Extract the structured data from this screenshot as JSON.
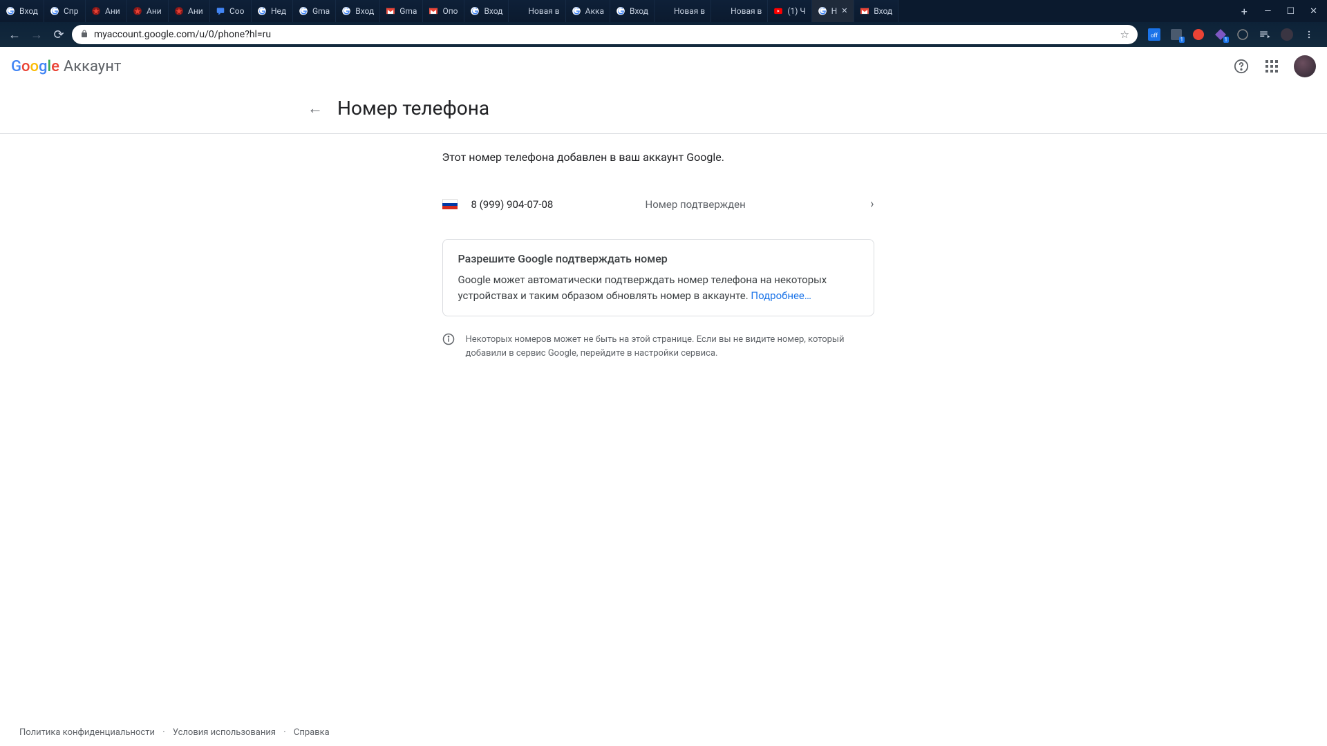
{
  "browser": {
    "tabs": [
      {
        "label": "Вход",
        "icon": "google"
      },
      {
        "label": "Спр",
        "icon": "google"
      },
      {
        "label": "Ани",
        "icon": "red"
      },
      {
        "label": "Ани",
        "icon": "red"
      },
      {
        "label": "Ани",
        "icon": "red"
      },
      {
        "label": "Соо",
        "icon": "chat"
      },
      {
        "label": "Нед",
        "icon": "google"
      },
      {
        "label": "Gma",
        "icon": "google"
      },
      {
        "label": "Вход",
        "icon": "google"
      },
      {
        "label": "Gma",
        "icon": "gmail"
      },
      {
        "label": "Опо",
        "icon": "gmail"
      },
      {
        "label": "Вход",
        "icon": "google"
      },
      {
        "label": "Новая в",
        "icon": "none"
      },
      {
        "label": "Акка",
        "icon": "google"
      },
      {
        "label": "Вход",
        "icon": "google"
      },
      {
        "label": "Новая в",
        "icon": "none"
      },
      {
        "label": "Новая в",
        "icon": "none"
      },
      {
        "label": "(1) Ч",
        "icon": "youtube"
      },
      {
        "label": "Н",
        "icon": "google",
        "active": true,
        "close": true
      },
      {
        "label": "Вход",
        "icon": "gmail"
      }
    ],
    "url": "myaccount.google.com/u/0/phone?hl=ru"
  },
  "header": {
    "logo_account": "Аккаунт",
    "page_title": "Номер телефона"
  },
  "main": {
    "intro": "Этот номер телефона добавлен в ваш аккаунт Google.",
    "phone_number": "8 (999) 904-07-08",
    "phone_status": "Номер подтвержден",
    "card": {
      "title": "Разрешите Google подтверждать номер",
      "body": "Google может автоматически подтверждать номер телефона на некоторых устройствах и таким образом обновлять номер в аккаунте. ",
      "link": "Подробнее…"
    },
    "info": "Некоторых номеров может не быть на этой странице. Если вы не видите номер, который добавили в сервис Google, перейдите в настройки сервиса."
  },
  "footer": {
    "privacy": "Политика конфиденциальности",
    "terms": "Условия использования",
    "help": "Справка"
  }
}
